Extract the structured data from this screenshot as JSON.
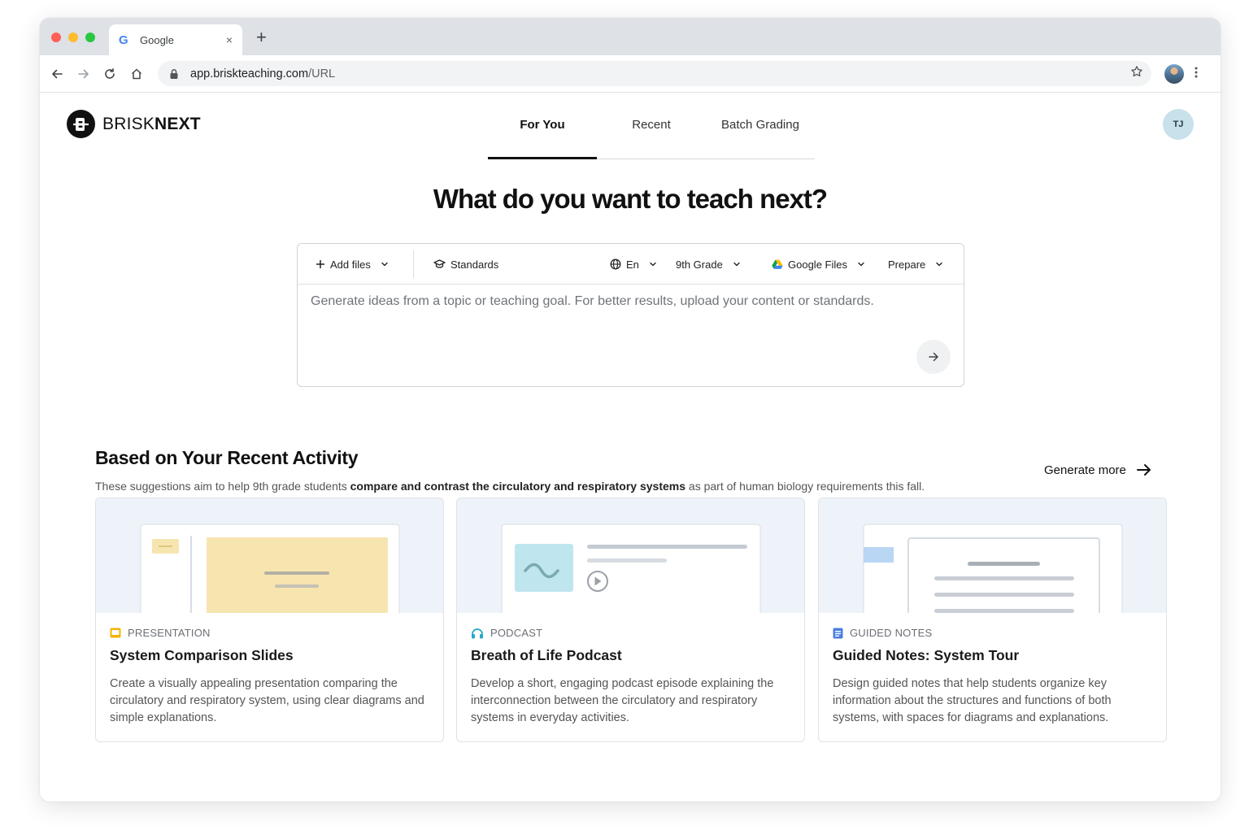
{
  "browser": {
    "tab_title": "Google",
    "tab_favicon": "G",
    "tab_close": "×",
    "new_tab": "+",
    "url_host": "app.briskteaching.com",
    "url_path": "/URL"
  },
  "app": {
    "logo_brand": "BRISK",
    "logo_suffix": "NEXT",
    "avatar_initials": "TJ"
  },
  "nav": {
    "tabs": [
      {
        "label": "For You",
        "active": true
      },
      {
        "label": "Recent",
        "active": false
      },
      {
        "label": "Batch Grading",
        "active": false
      }
    ]
  },
  "hero": {
    "title": "What do you want to teach next?"
  },
  "composer": {
    "add_files": "Add files",
    "standards": "Standards",
    "language": "En",
    "grade": "9th Grade",
    "source": "Google Files",
    "mode": "Prepare",
    "placeholder": "Generate ideas from a topic or teaching goal. For better results, upload your content or standards."
  },
  "recent": {
    "title": "Based on Your Recent Activity",
    "desc_prefix": "These suggestions aim to help 9th grade students ",
    "desc_bold": "compare and contrast the circulatory and respiratory systems",
    "desc_suffix": " as part of human biology requirements this fall.",
    "generate_more": "Generate more"
  },
  "cards": [
    {
      "type": "PRESENTATION",
      "icon": "presentation-icon",
      "title": "System Comparison Slides",
      "description": "Create a visually appealing presentation comparing the circulatory and respiratory system, using clear diagrams and simple explanations."
    },
    {
      "type": "PODCAST",
      "icon": "headphones-icon",
      "title": "Breath of Life Podcast",
      "description": "Develop a short, engaging podcast episode explaining the interconnection between the circulatory and respiratory systems in everyday activities."
    },
    {
      "type": "GUIDED NOTES",
      "icon": "notes-icon",
      "title": "Guided Notes: System Tour",
      "description": "Design guided notes that help students organize key information about the structures and functions of both systems, with spaces for diagrams and explanations."
    }
  ],
  "colors": {
    "presentation": "#f4b400",
    "podcast": "#23a9c8",
    "guided_notes": "#4a7fe0",
    "thumb_bg": "#eef3fa",
    "slide_yellow": "#f7e5b0",
    "podcast_tile": "#bfe6ee",
    "notes_tab": "#b9d6f5"
  }
}
